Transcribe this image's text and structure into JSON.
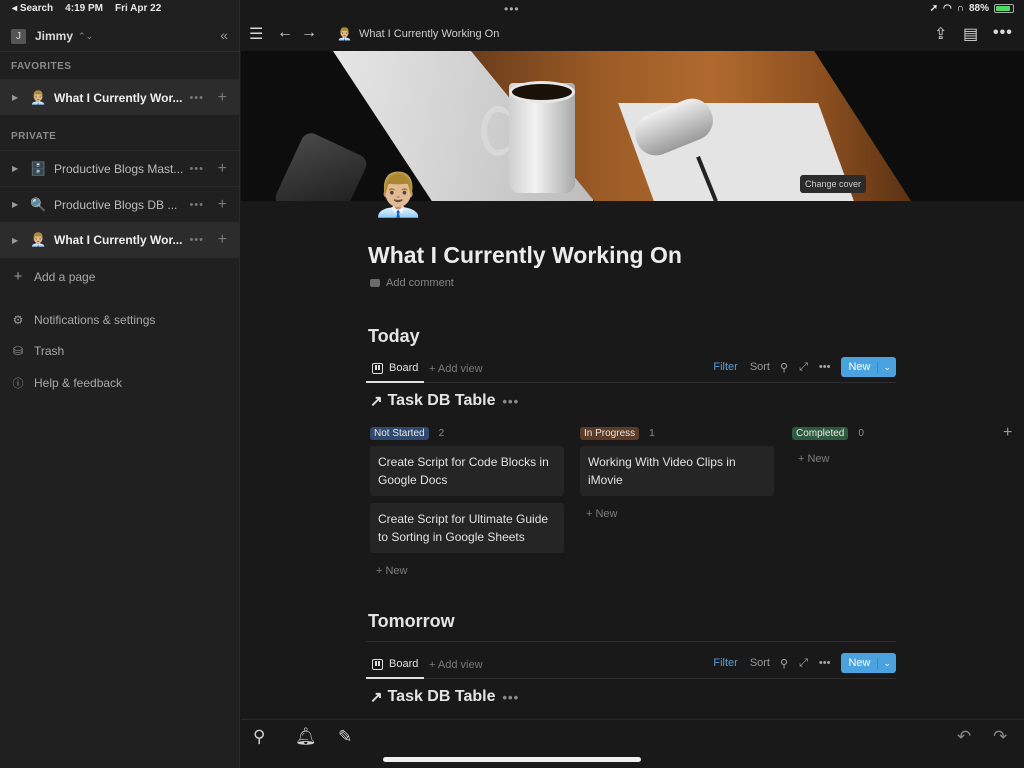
{
  "status_bar": {
    "back_app": "Search",
    "time": "4:19 PM",
    "date": "Fri Apr 22",
    "battery": "88%",
    "battery_level": 0.88,
    "center_dots": "•••"
  },
  "sidebar": {
    "workspace_initial": "J",
    "workspace_name": "Jimmy",
    "favorites_label": "FAVORITES",
    "favorites": [
      {
        "emoji": "👨🏼‍💼",
        "label": "What I Currently Working On",
        "display": "What I Currently Wor..."
      }
    ],
    "private_label": "PRIVATE",
    "private": [
      {
        "emoji": "🗄️",
        "label": "Productive Blogs Mast...",
        "icon": "file-cabinet-icon"
      },
      {
        "emoji": "🔍",
        "label": "Productive Blogs DB ...",
        "icon": "magnifier-icon"
      },
      {
        "emoji": "👨🏼‍💼",
        "label": "What I Currently Wor...",
        "icon": "person-icon"
      }
    ],
    "add_page": "Add a page",
    "links": [
      {
        "icon": "gear-icon",
        "label": "Notifications & settings"
      },
      {
        "icon": "trash-icon",
        "label": "Trash"
      },
      {
        "icon": "help-icon",
        "label": "Help & feedback"
      }
    ]
  },
  "topbar": {
    "breadcrumb_emoji": "👨🏼‍💼",
    "breadcrumb": "What I Currently Working On"
  },
  "page": {
    "change_cover": "Change cover",
    "icon": "👨🏼‍💼",
    "title": "What I Currently Working On",
    "add_comment": "Add comment"
  },
  "sections": [
    {
      "title": "Today",
      "view_tab": "Board",
      "add_view": "Add view",
      "filter": "Filter",
      "sort": "Sort",
      "new_button": "New",
      "db_title": "Task DB Table",
      "columns": [
        {
          "status": "Not Started",
          "color": "#2f4a6e",
          "count": "2",
          "cards": [
            "Create Script for Code Blocks in Google Docs",
            "Create Script for Ultimate Guide to Sorting in Google Sheets"
          ],
          "new_label": "New"
        },
        {
          "status": "In Progress",
          "color": "#5c3b27",
          "count": "1",
          "cards": [
            "Working With Video Clips in iMovie"
          ],
          "new_label": "New"
        },
        {
          "status": "Completed",
          "color": "#2f5a3f",
          "count": "0",
          "cards": [],
          "new_label": "New"
        }
      ]
    },
    {
      "title": "Tomorrow",
      "view_tab": "Board",
      "add_view": "Add view",
      "filter": "Filter",
      "sort": "Sort",
      "new_button": "New",
      "db_title": "Task DB Table"
    }
  ],
  "colors": {
    "accent": "#4aa3df",
    "filter": "#5b9fd6",
    "background": "#191919",
    "sidebar": "#202020"
  }
}
